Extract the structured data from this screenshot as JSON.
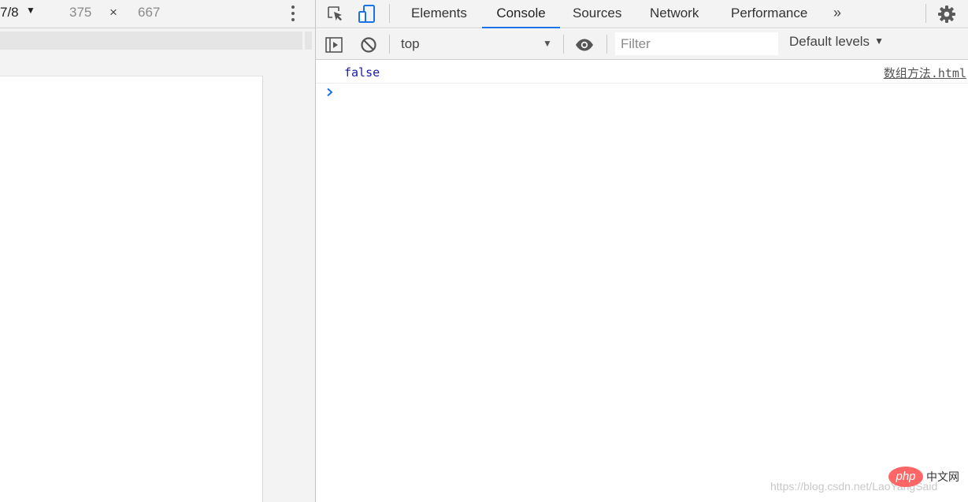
{
  "device_toolbar": {
    "device_name": "7/8",
    "width_value": "375",
    "times_symbol": "×",
    "height_value": "667"
  },
  "tabs": {
    "elements": "Elements",
    "console": "Console",
    "sources": "Sources",
    "network": "Network",
    "performance": "Performance",
    "overflow_glyph": "»",
    "active": "Console"
  },
  "console_toolbar": {
    "context_value": "top",
    "filter_placeholder": "Filter",
    "levels_label": "Default levels",
    "caret_glyph": "▼"
  },
  "console": {
    "messages": [
      {
        "value": "false",
        "source": "数组方法.html"
      }
    ]
  },
  "watermark": {
    "url_text": "https://blog.csdn.net/LaoYangSaid",
    "logo_text": "php",
    "logo_caption": "中文网"
  },
  "colors": {
    "accent": "#1a73e8",
    "toolbar_bg": "#f3f3f3",
    "value_blue": "#1a1aa6",
    "logo_red": "#ff6666"
  },
  "icons": [
    "select-element-icon",
    "device-toolbar-icon",
    "more-vertical-icon",
    "sidebar-toggle-icon",
    "clear-console-icon",
    "eye-icon",
    "gear-icon",
    "prompt-caret-icon"
  ]
}
